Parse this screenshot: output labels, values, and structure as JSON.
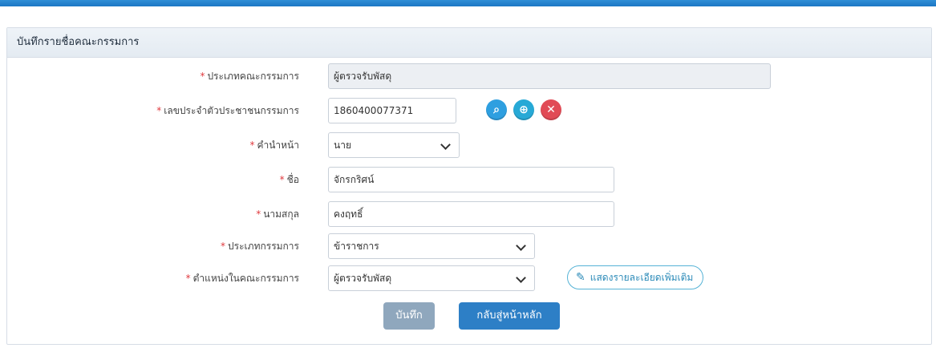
{
  "header": {
    "title": "บันทึกรายชื่อคณะกรรมการ"
  },
  "form": {
    "committee_type": {
      "label": "ประเภทคณะกรรมการ",
      "value": "ผู้ตรวจรับพัสดุ"
    },
    "citizen_id": {
      "label": "เลขประจำตัวประชาชนกรรมการ",
      "value": "1860400077371"
    },
    "prefix": {
      "label": "คำนำหน้า",
      "value": "นาย"
    },
    "first_name": {
      "label": "ชื่อ",
      "value": "จักรกริศน์"
    },
    "last_name": {
      "label": "นามสกุล",
      "value": "คงฤทธิ์"
    },
    "member_type": {
      "label": "ประเภทกรรมการ",
      "value": "ข้าราชการ"
    },
    "position": {
      "label": "ตำแหน่งในคณะกรรมการ",
      "value": "ผู้ตรวจรับพัสดุ"
    },
    "required_mark": "*"
  },
  "actions": {
    "detail_label": "แสดงรายละเอียดเพิ่มเติม",
    "save_label": "บันทึก",
    "back_label": "กลับสู่หน้าหลัก"
  },
  "icons": {
    "search": "search-icon",
    "zoom": "zoom-in-icon",
    "clear": "close-icon",
    "edit": "edit-icon"
  },
  "colors": {
    "accent": "#2d7fc6",
    "required": "#e0393e",
    "save_disabled": "#8fa7bd"
  }
}
